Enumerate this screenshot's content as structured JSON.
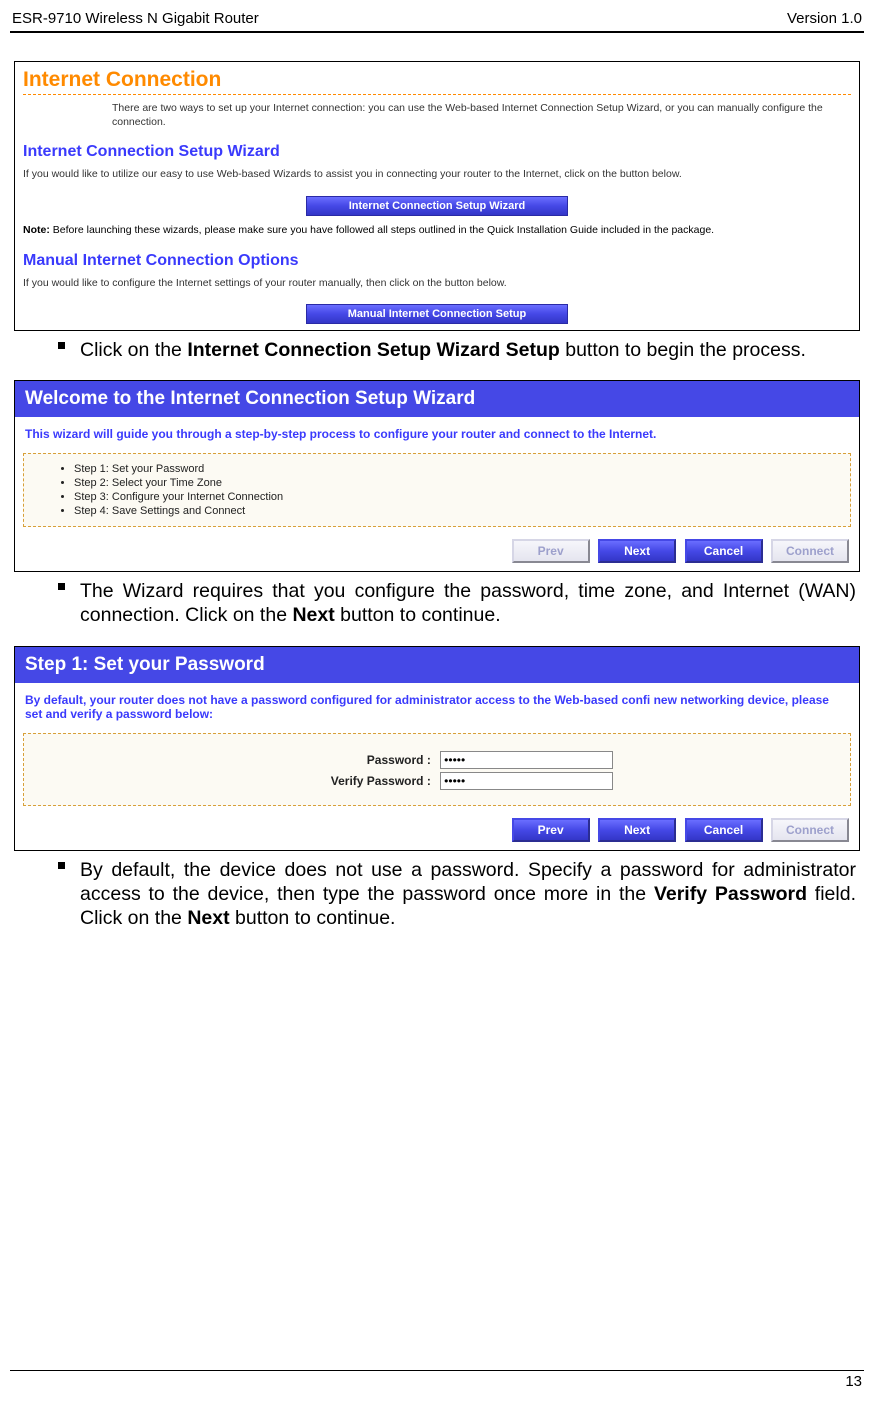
{
  "header": {
    "product": "ESR-9710 Wireless N Gigabit Router",
    "version": "Version 1.0"
  },
  "screenshot1": {
    "title": "Internet Connection",
    "intro": "There are two ways to set up your Internet connection: you can use the Web-based Internet Connection Setup Wizard, or you can manually configure the connection.",
    "sub1_title": "Internet Connection Setup Wizard",
    "sub1_body": "If you would like to utilize our easy to use Web-based Wizards to assist you in connecting your router to the Internet, click on the button below.",
    "btn1": "Internet Connection Setup Wizard",
    "note_label": "Note:",
    "note_body": "Before launching these wizards, please make sure you have followed all steps outlined in the Quick Installation Guide included in the package.",
    "sub2_title": "Manual Internet Connection Options",
    "sub2_body": "If you would like to configure the Internet settings of your router manually, then click on the button below.",
    "btn2": "Manual Internet Connection Setup"
  },
  "instr1": {
    "pre": "Click on the ",
    "bold": "Internet Connection Setup Wizard Setup",
    "post": " button to begin the process."
  },
  "screenshot2": {
    "welcome": "Welcome to the Internet Connection Setup Wizard",
    "subtext": "This wizard will guide you through a step-by-step process to configure your router and connect to the Internet.",
    "steps": [
      "Step 1: Set your Password",
      "Step 2: Select your Time Zone",
      "Step 3: Configure your Internet Connection",
      "Step 4: Save Settings and Connect"
    ],
    "nav": {
      "prev": "Prev",
      "next": "Next",
      "cancel": "Cancel",
      "connect": "Connect"
    }
  },
  "instr2": {
    "pre": "The Wizard requires that you configure the password, time zone, and Internet (WAN) connection. Click on the ",
    "bold": "Next",
    "post": " button to continue."
  },
  "screenshot3": {
    "title": "Step 1: Set your Password",
    "subtext": "By default, your router does not have a password configured for administrator access to the Web-based confi new networking device, please set and verify a password below:",
    "pw_label": "Password :",
    "vpw_label": "Verify Password :",
    "pw_value": "•••••",
    "vpw_value": "•••••",
    "nav": {
      "prev": "Prev",
      "next": "Next",
      "cancel": "Cancel",
      "connect": "Connect"
    }
  },
  "instr3": {
    "pre": "By default, the device does not use a password. Specify a password for administrator access to the device, then type the password once more in the ",
    "bold1": "Verify Password",
    "mid": " field.  Click on the ",
    "bold2": "Next",
    "post": " button to continue."
  },
  "page_number": "13"
}
